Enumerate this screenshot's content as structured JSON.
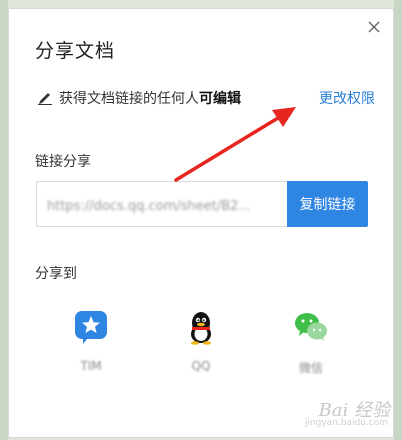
{
  "dialog": {
    "title": "分享文档",
    "permission": {
      "prefix": "获得文档链接的任何人",
      "mode": "可编辑",
      "change_link": "更改权限"
    },
    "link_share": {
      "label": "链接分享",
      "url": "https://docs.qq.com/sheet/B2...",
      "copy_label": "复制链接"
    },
    "share_to": {
      "label": "分享到",
      "targets": [
        {
          "label": "TIM",
          "icon": "tim-icon",
          "color": "#2f86e2"
        },
        {
          "label": "QQ",
          "icon": "qq-penguin-icon",
          "color": "#111111"
        },
        {
          "label": "微信",
          "icon": "wechat-icon",
          "color": "#3fbf4a"
        }
      ]
    }
  },
  "watermark": {
    "text": "Bai 经验",
    "sub": "jingyan.baidu.com"
  },
  "colors": {
    "accent": "#2f86e2",
    "link": "#2a7fd6",
    "annotation_arrow": "#e8251f"
  }
}
